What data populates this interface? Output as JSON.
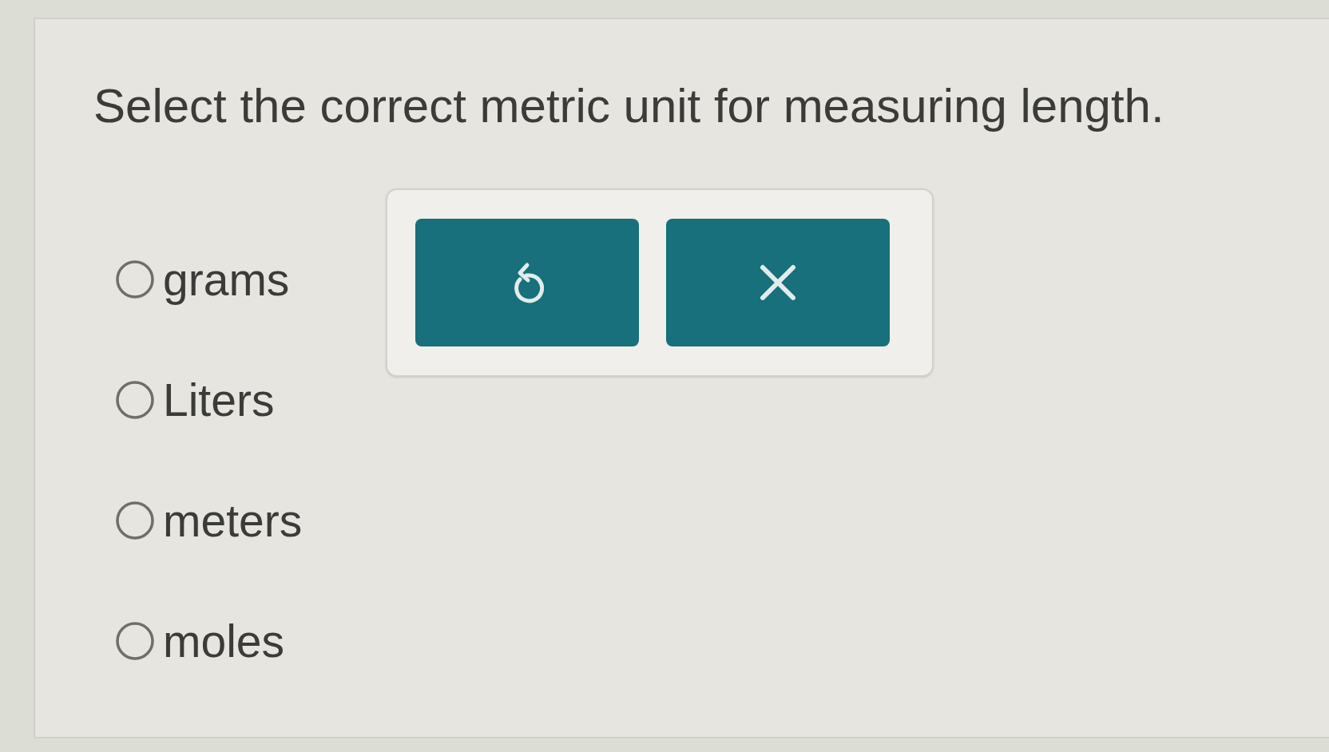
{
  "question": "Select the correct metric unit for measuring length.",
  "options": [
    {
      "label": "grams",
      "selected": false
    },
    {
      "label": "Liters",
      "selected": false
    },
    {
      "label": "meters",
      "selected": false
    },
    {
      "label": "moles",
      "selected": false
    }
  ],
  "toolbar": {
    "buttons": [
      {
        "kind": "reset"
      },
      {
        "kind": "close"
      }
    ]
  }
}
